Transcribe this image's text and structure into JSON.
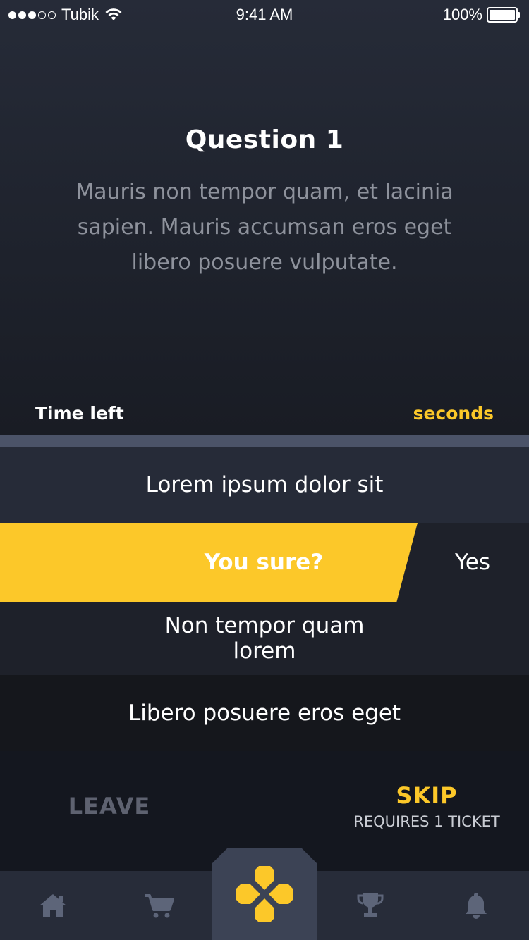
{
  "status_bar": {
    "carrier": "Tubik",
    "signal_dots_filled": 3,
    "signal_dots_total": 5,
    "time": "9:41 AM",
    "battery": "100%"
  },
  "question": {
    "title": "Question 1",
    "text": "Mauris non tempor quam, et lacinia sapien. Mauris accumsan eros eget libero posuere vulputate."
  },
  "timer": {
    "label": "Time left",
    "unit": "seconds",
    "progress_remaining": 0
  },
  "answers": [
    {
      "label": "Lorem ipsum dolor sit"
    },
    {
      "label": "",
      "confirm_prompt": "You sure?",
      "confirm_action": "Yes"
    },
    {
      "label": "Non tempor quam lorem"
    },
    {
      "label": "Libero posuere eros eget"
    }
  ],
  "actions": {
    "leave": "LEAVE",
    "skip": "SKIP",
    "skip_requirement": "REQUIRES 1 TICKET"
  },
  "tabbar": {
    "items": [
      "home-icon",
      "cart-icon",
      "app-logo-icon",
      "trophy-icon",
      "bell-icon"
    ],
    "active": "app-logo-icon"
  },
  "colors": {
    "accent": "#fcc829",
    "background": "#1e222c",
    "tabbar": "#272c39",
    "tab_active": "#3c4355",
    "muted_text": "#8e929c"
  }
}
